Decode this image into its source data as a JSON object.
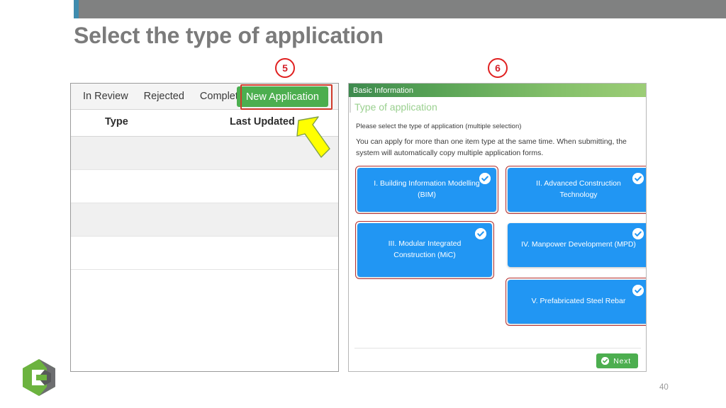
{
  "slide": {
    "title": "Select the type of application",
    "page_number": "40",
    "logo_name": "company-hexagon-logo",
    "accent_bar_color": "#3f8cae",
    "top_bar_color": "#808181",
    "title_color": "#7b7b7b"
  },
  "callouts": [
    {
      "number": "5"
    },
    {
      "number": "6"
    }
  ],
  "left_panel": {
    "tabs": [
      {
        "label": "In Review"
      },
      {
        "label": "Rejected"
      },
      {
        "label": "Completed"
      }
    ],
    "new_application_button": {
      "label": "New Application",
      "color": "#4cae4f",
      "highlight_color": "#d03a2a"
    },
    "table": {
      "columns": [
        "Type",
        "Last Updated"
      ],
      "rows": [
        {
          "type": "",
          "last_updated": ""
        },
        {
          "type": "",
          "last_updated": ""
        },
        {
          "type": "",
          "last_updated": ""
        },
        {
          "type": "",
          "last_updated": ""
        }
      ]
    },
    "arrow_name": "yellow-pointer-arrow",
    "arrow_color": "#ffff00"
  },
  "right_panel": {
    "header_title": "Basic Information",
    "section_title": "Type of application",
    "instruction_1": "Please select the type of application (multiple selection)",
    "instruction_2": "You can apply for more than one item type at the same time. When submitting, the system will automatically copy multiple application forms.",
    "tile_color": "#2196f3",
    "outline_color": "#b5302f",
    "tiles": [
      {
        "label": "I. Building Information Modelling (BIM)",
        "selected": true,
        "highlighted": true
      },
      {
        "label": "II. Advanced Construction Technology",
        "selected": true,
        "highlighted": true
      },
      {
        "label": "III. Modular Integrated Construction (MiC)",
        "selected": true,
        "highlighted": true
      },
      {
        "label": "IV. Manpower Development (MPD)",
        "selected": true,
        "highlighted": false
      },
      {
        "label": "V. Prefabricated Steel Rebar",
        "selected": true,
        "highlighted": true
      }
    ],
    "next_button": {
      "label": "Next",
      "color": "#4cae4f"
    }
  }
}
